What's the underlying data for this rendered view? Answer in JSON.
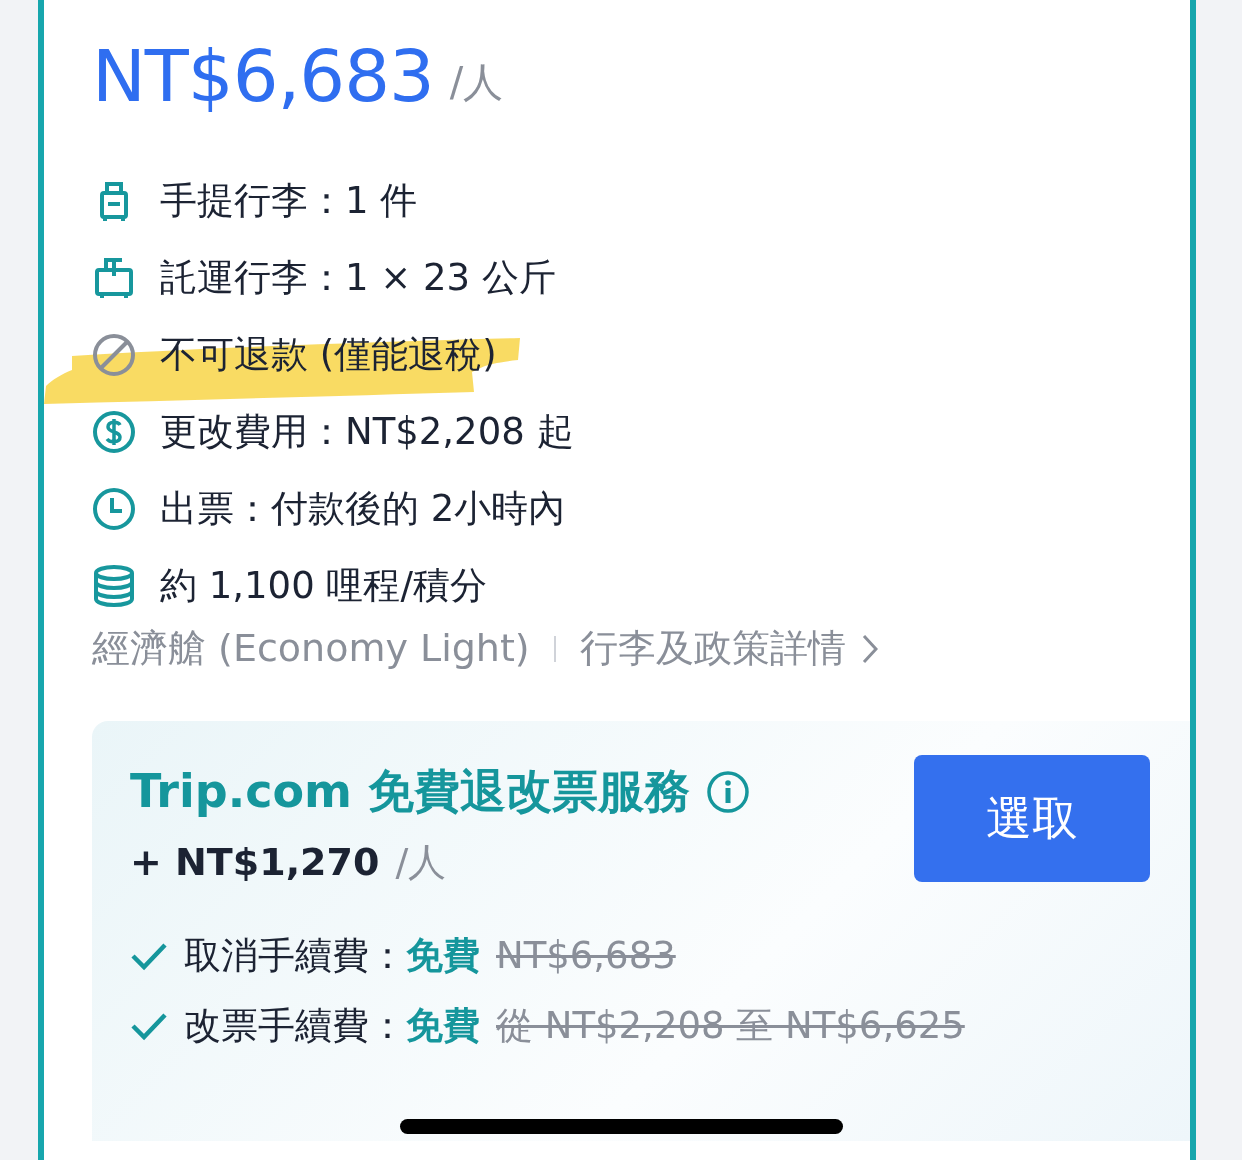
{
  "price": {
    "amount": "NT$6,683",
    "unit": "/人"
  },
  "features": [
    {
      "kind": "carry-on",
      "text": "手提行李：1 件",
      "highlighted": false
    },
    {
      "kind": "checked-bag",
      "text": "託運行李：1 × 23 公斤",
      "highlighted": false
    },
    {
      "kind": "no-refund",
      "text": "不可退款 (僅能退稅)",
      "highlighted": true
    },
    {
      "kind": "fee",
      "text": "更改費用：NT$2,208 起",
      "highlighted": false
    },
    {
      "kind": "clock",
      "text": "出票：付款後的 2小時內",
      "highlighted": false
    },
    {
      "kind": "coins",
      "text": "約 1,100 哩程/積分",
      "highlighted": false
    }
  ],
  "fare_class": "經濟艙 (Economy Light)",
  "policy_link": "行李及政策詳情",
  "service": {
    "title": "Trip.com 免費退改票服務",
    "price": "+ NT$1,270",
    "unit": "/人",
    "button": "選取",
    "benefits": [
      {
        "label": "取消手續費：",
        "value": "免費",
        "original": "NT$6,683"
      },
      {
        "label": "改票手續費：",
        "value": "免費",
        "original": "從 NT$2,208 至 NT$6,625"
      }
    ]
  }
}
